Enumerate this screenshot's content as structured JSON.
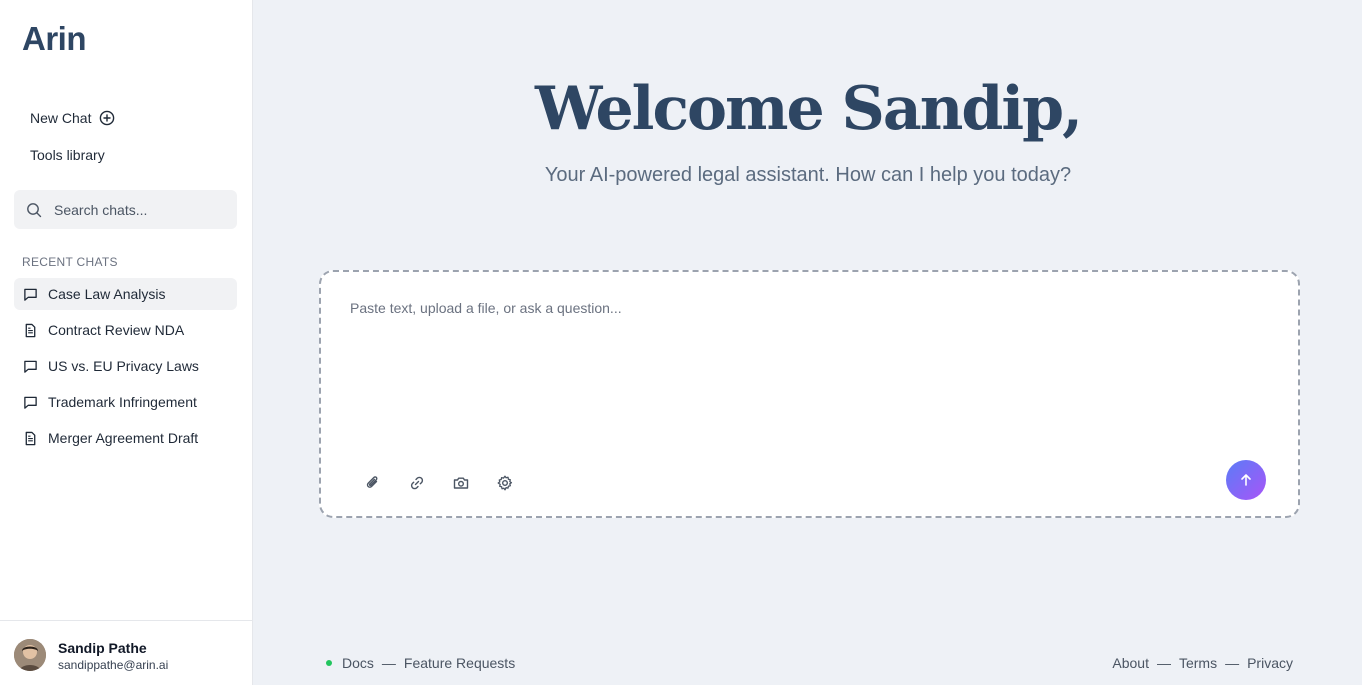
{
  "app": {
    "logo": "Arin"
  },
  "sidebar": {
    "new_chat_label": "New Chat",
    "tools_label": "Tools library",
    "search_placeholder": "Search chats...",
    "recent_label": "RECENT CHATS",
    "chats": [
      {
        "label": "Case Law Analysis",
        "icon": "chat-bubble-icon",
        "active": true
      },
      {
        "label": "Contract Review NDA",
        "icon": "document-icon",
        "active": false
      },
      {
        "label": "US vs. EU Privacy Laws",
        "icon": "chat-bubble-icon",
        "active": false
      },
      {
        "label": "Trademark Infringement",
        "icon": "chat-bubble-icon",
        "active": false
      },
      {
        "label": "Merger Agreement Draft",
        "icon": "document-icon",
        "active": false
      }
    ]
  },
  "user": {
    "name": "Sandip Pathe",
    "email": "sandippathe@arin.ai"
  },
  "main": {
    "welcome": "Welcome Sandip,",
    "subtitle": "Your AI-powered legal assistant. How can I help you today?",
    "composer_placeholder": "Paste text, upload a file, or ask a question...",
    "tools": [
      "paperclip-icon",
      "link-icon",
      "camera-icon",
      "gear-icon"
    ],
    "send_icon": "arrow-up-icon"
  },
  "footer": {
    "left": [
      "Docs",
      "Feature Requests"
    ],
    "right": [
      "About",
      "Terms",
      "Privacy"
    ],
    "separator": "—",
    "status_color": "#22c55e"
  },
  "colors": {
    "brand": "#2e4663",
    "background": "#eef1f6",
    "send_gradient_start": "#5b7cf7",
    "send_gradient_end": "#a855f7"
  }
}
